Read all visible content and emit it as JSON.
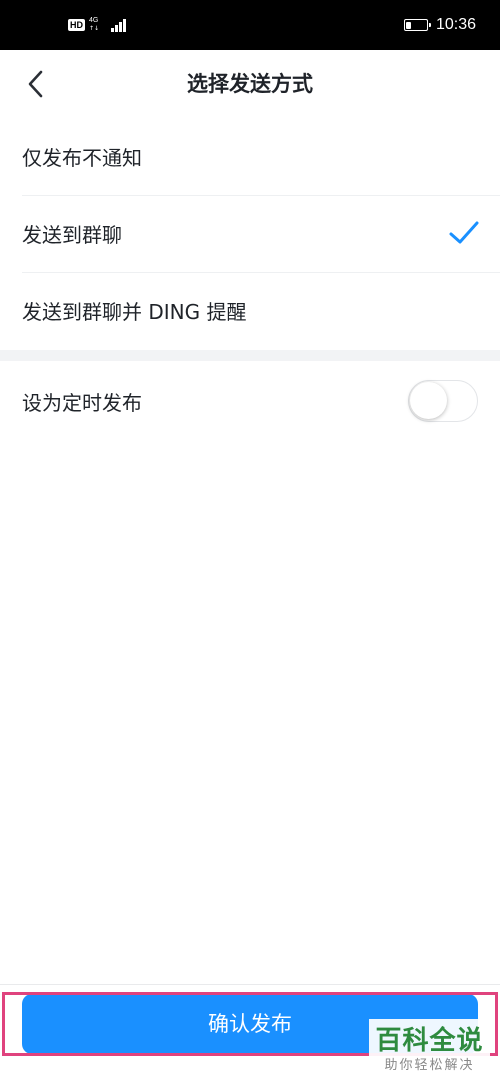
{
  "status_bar": {
    "hd": "HD",
    "network": "4G",
    "network_arrows": "↑↓",
    "battery_level": 0.25,
    "time": "10:36"
  },
  "header": {
    "back_icon": "chevron-left-icon",
    "title": "选择发送方式"
  },
  "options": [
    {
      "label": "仅发布不通知",
      "selected": false
    },
    {
      "label": "发送到群聊",
      "selected": true
    },
    {
      "label": "发送到群聊并 DING 提醒",
      "selected": false
    }
  ],
  "schedule": {
    "label": "设为定时发布",
    "enabled": false
  },
  "footer": {
    "confirm_label": "确认发布"
  },
  "watermark": {
    "title": "百科全说",
    "subtitle": "助你轻松解决"
  },
  "colors": {
    "accent": "#1a90ff",
    "highlight": "#e0437e",
    "watermark_green": "#2e8b3f"
  }
}
